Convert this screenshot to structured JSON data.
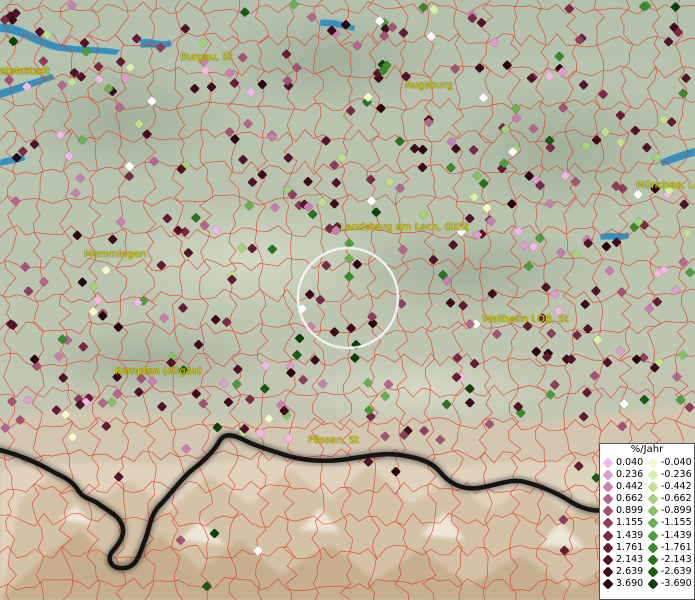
{
  "cities": [
    {
      "name": "Ingolstadt",
      "label": "statsstadt"
    },
    {
      "name": "Burgau",
      "label": "Burgau, St"
    },
    {
      "name": "Augsburg",
      "label": "Augsburg"
    },
    {
      "name": "Muenchen",
      "label": "München, La"
    },
    {
      "name": "Landsberg",
      "label": "Landsberg am Lech, GKSt"
    },
    {
      "name": "Memmingen",
      "label": "Memmingen"
    },
    {
      "name": "Weilheim",
      "label": "Weilheim i.OB, St"
    },
    {
      "name": "Kempten",
      "label": "Kempten (Allgäu)"
    },
    {
      "name": "Fuessen",
      "label": "Füssen, St"
    }
  ],
  "legend": {
    "title": "%/Jahr",
    "positive": [
      "0.040",
      "0.236",
      "0.442",
      "0.662",
      "0.899",
      "1.155",
      "1.439",
      "1.761",
      "2.143",
      "2.639",
      "3.690"
    ],
    "negative": [
      "-0.040",
      "-0.236",
      "-0.442",
      "-0.662",
      "-0.899",
      "-1.155",
      "-1.439",
      "-1.761",
      "-2.143",
      "-2.639",
      "-3.690"
    ],
    "positive_colors": [
      "#f2b8e6",
      "#e09ccd",
      "#c97fb0",
      "#b5668f",
      "#a65275",
      "#8f3d5c",
      "#7a2a45",
      "#651b34",
      "#521227",
      "#400a1b",
      "#2c0410"
    ],
    "negative_colors": [
      "#f4f9cc",
      "#dbeeaa",
      "#c0e08f",
      "#a3d27a",
      "#86c263",
      "#69b04f",
      "#4f9c3b",
      "#3a8a2b",
      "#27731f",
      "#185c14",
      "#0a430a"
    ]
  },
  "colors": {
    "water": "#3a8fb8",
    "border": "#e43a2a",
    "label": "#d8d000",
    "highlight_circle": "#f5f5f5",
    "national_border": "#1a1a1a"
  }
}
